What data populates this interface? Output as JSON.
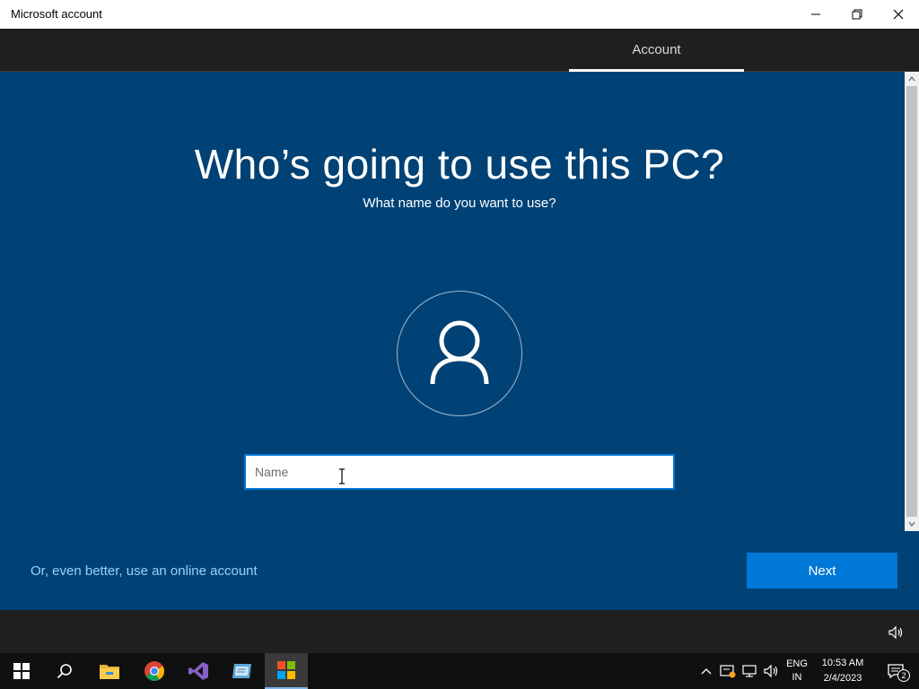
{
  "window": {
    "title": "Microsoft account",
    "controls": [
      "minimize",
      "restore",
      "close"
    ]
  },
  "header": {
    "tab_label": "Account"
  },
  "main": {
    "heading": "Who’s going to use this PC?",
    "subheading": "What name do you want to use?",
    "avatar_icon": "user-icon",
    "name_field": {
      "placeholder": "Name",
      "value": ""
    },
    "online_account_link": "Or, even better, use an online account",
    "next_label": "Next"
  },
  "taskbar": {
    "apps": [
      "start-icon",
      "search-icon",
      "file-explorer-icon",
      "chrome-icon",
      "visual-studio-icon",
      "app-icon",
      "microsoft-store-icon"
    ],
    "language": {
      "line1": "ENG",
      "line2": "IN"
    },
    "clock": {
      "time": "10:53 AM",
      "date": "2/4/2023"
    },
    "notification_count": "2"
  },
  "colors": {
    "background": "#004275",
    "accent": "#0078d7",
    "link": "#9bd0ff",
    "bar": "#1f1f1f"
  }
}
